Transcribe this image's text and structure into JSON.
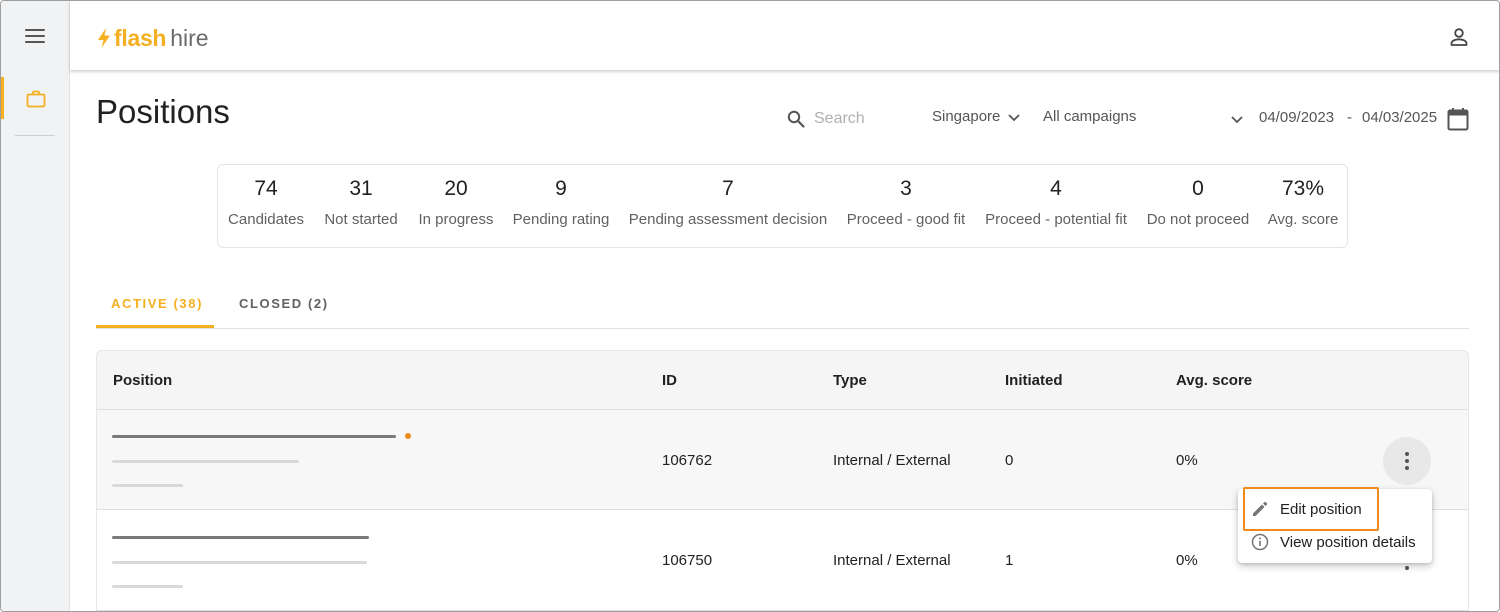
{
  "app": {
    "logo_flash": "flash",
    "logo_hire": "hire"
  },
  "page": {
    "title": "Positions"
  },
  "filters": {
    "search_placeholder": "Search",
    "country": "Singapore",
    "campaign": "All campaigns",
    "date_from": "04/09/2023",
    "date_separator": "-",
    "date_to": "04/03/2025"
  },
  "stats": [
    {
      "value": "74",
      "label": "Candidates"
    },
    {
      "value": "31",
      "label": "Not started"
    },
    {
      "value": "20",
      "label": "In progress"
    },
    {
      "value": "9",
      "label": "Pending rating"
    },
    {
      "value": "7",
      "label": "Pending assessment decision"
    },
    {
      "value": "3",
      "label": "Proceed - good fit"
    },
    {
      "value": "4",
      "label": "Proceed - potential fit"
    },
    {
      "value": "0",
      "label": "Do not proceed"
    },
    {
      "value": "73%",
      "label": "Avg. score"
    }
  ],
  "tabs": [
    {
      "label": "ACTIVE (38)",
      "active": true
    },
    {
      "label": "CLOSED (2)",
      "active": false
    }
  ],
  "table": {
    "headers": [
      "Position",
      "ID",
      "Type",
      "Initiated",
      "Avg. score"
    ],
    "rows": [
      {
        "id": "106762",
        "type": "Internal / External",
        "initiated": "0",
        "avg_score": "0%"
      },
      {
        "id": "106750",
        "type": "Internal / External",
        "initiated": "1",
        "avg_score": "0%"
      }
    ]
  },
  "menu": {
    "edit_label": "Edit position",
    "view_label": "View position details"
  },
  "colors": {
    "accent": "#f5b021",
    "highlight": "#f08a19"
  }
}
